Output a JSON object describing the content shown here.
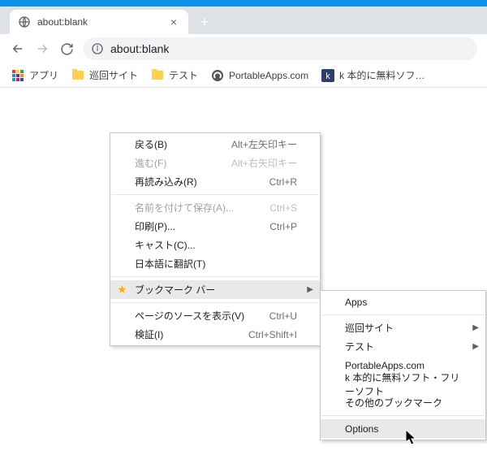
{
  "tab": {
    "title": "about:blank"
  },
  "omnibox": {
    "url": "about:blank"
  },
  "bookmarks_bar": [
    {
      "label": "アプリ",
      "type": "apps"
    },
    {
      "label": "巡回サイト",
      "type": "folder"
    },
    {
      "label": "テスト",
      "type": "folder"
    },
    {
      "label": "PortableApps.com",
      "type": "site-pa"
    },
    {
      "label": "k 本的に無料ソフ…",
      "type": "site-k"
    }
  ],
  "context_menu": {
    "back": {
      "label": "戻る(B)",
      "shortcut": "Alt+左矢印キー"
    },
    "forward": {
      "label": "進む(F)",
      "shortcut": "Alt+右矢印キー"
    },
    "reload": {
      "label": "再読み込み(R)",
      "shortcut": "Ctrl+R"
    },
    "save_as": {
      "label": "名前を付けて保存(A)...",
      "shortcut": "Ctrl+S"
    },
    "print": {
      "label": "印刷(P)...",
      "shortcut": "Ctrl+P"
    },
    "cast": {
      "label": "キャスト(C)...",
      "shortcut": ""
    },
    "translate": {
      "label": "日本語に翻訳(T)",
      "shortcut": ""
    },
    "bookmark_bar": {
      "label": "ブックマーク バー",
      "shortcut": ""
    },
    "view_source": {
      "label": "ページのソースを表示(V)",
      "shortcut": "Ctrl+U"
    },
    "inspect": {
      "label": "検証(I)",
      "shortcut": "Ctrl+Shift+I"
    }
  },
  "submenu": {
    "apps": {
      "label": "Apps"
    },
    "junkai": {
      "label": "巡回サイト"
    },
    "test": {
      "label": "テスト"
    },
    "portableapps": {
      "label": "PortableApps.com"
    },
    "khonteki": {
      "label": "k 本的に無料ソフト・フリーソフト"
    },
    "other": {
      "label": "その他のブックマーク"
    },
    "options": {
      "label": "Options"
    }
  }
}
